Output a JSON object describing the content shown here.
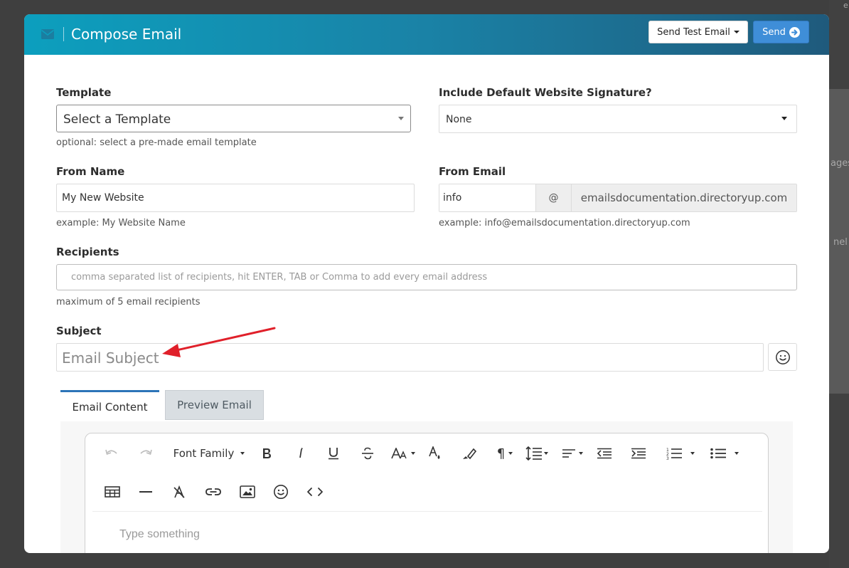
{
  "backdrop": {
    "fragments": [
      "ages",
      "nel",
      "e"
    ]
  },
  "header": {
    "title": "Compose Email",
    "send_test_label": "Send Test Email",
    "send_label": "Send",
    "gradient_start": "#0c9fbe",
    "gradient_end": "#1f5a7c"
  },
  "form": {
    "template": {
      "label": "Template",
      "value": "Select a Template",
      "help": "optional: select a pre-made email template"
    },
    "signature": {
      "label": "Include Default Website Signature?",
      "value": "None"
    },
    "from_name": {
      "label": "From Name",
      "value": "My New Website",
      "help": "example: My Website Name"
    },
    "from_email": {
      "label": "From Email",
      "user": "info",
      "at": "@",
      "domain": "emailsdocumentation.directoryup.com",
      "help": "example: info@emailsdocumentation.directoryup.com"
    },
    "recipients": {
      "label": "Recipients",
      "placeholder": "comma separated list of recipients, hit ENTER, TAB or Comma to add every email address",
      "help": "maximum of 5 email recipients"
    },
    "subject": {
      "label": "Subject",
      "placeholder": "Email Subject"
    }
  },
  "tabs": [
    {
      "label": "Email Content",
      "active": true
    },
    {
      "label": "Preview Email",
      "active": false
    }
  ],
  "editor": {
    "font_family_label": "Font Family",
    "placeholder": "Type something",
    "toolbar_icons": [
      "undo-icon",
      "redo-icon",
      "font-family-dropdown",
      "bold-icon",
      "italic-icon",
      "underline-icon",
      "strikethrough-icon",
      "font-size-icon",
      "text-color-icon",
      "highlight-icon",
      "paragraph-format-icon",
      "line-height-icon",
      "align-icon",
      "outdent-icon",
      "indent-icon",
      "ordered-list-icon",
      "unordered-list-icon",
      "table-icon",
      "horizontal-line-icon",
      "clear-format-icon",
      "link-icon",
      "image-icon",
      "emoticon-icon",
      "code-view-icon"
    ]
  },
  "colors": {
    "accent": "#2c74b8",
    "send_button": "#3f8ed8",
    "annotation_arrow": "#e0202a"
  }
}
